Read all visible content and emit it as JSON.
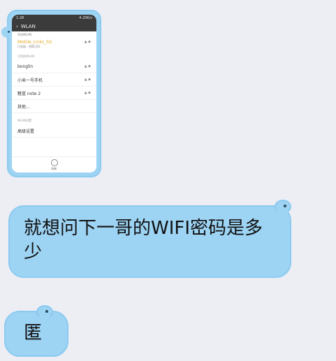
{
  "image_message": {
    "phone_screenshot": {
      "status_bar": {
        "left": "1:28",
        "right": "4.20K/s"
      },
      "title": "WLAN",
      "subtitle": "开启WLAN",
      "connected_network": {
        "name": "Mobile_Links_5G",
        "status": "已连接，网络可用"
      },
      "available_section_title": "可用的WLAN",
      "networks": [
        {
          "name": "bonglin",
          "meta": "▲ ◆"
        },
        {
          "name": "小米一号手机",
          "meta": "▲ ◆"
        },
        {
          "name": "魅蓝 note 2",
          "meta": "▲ ◆"
        },
        {
          "name": "其他...",
          "meta": ""
        }
      ],
      "advanced_section_title": "WLAN设置",
      "advanced_item": "高级设置",
      "bottom_label": "刷新"
    }
  },
  "messages": [
    {
      "text": "就想问下一哥的WIFI密码是多少"
    },
    {
      "text": "匿"
    }
  ],
  "colors": {
    "background": "#eceef4",
    "bubble": "#9dd3f3",
    "bubble_border": "#8ccaf0",
    "phone_bar": "#3b3b3b",
    "wifi_connected_text": "#e3a71f"
  }
}
